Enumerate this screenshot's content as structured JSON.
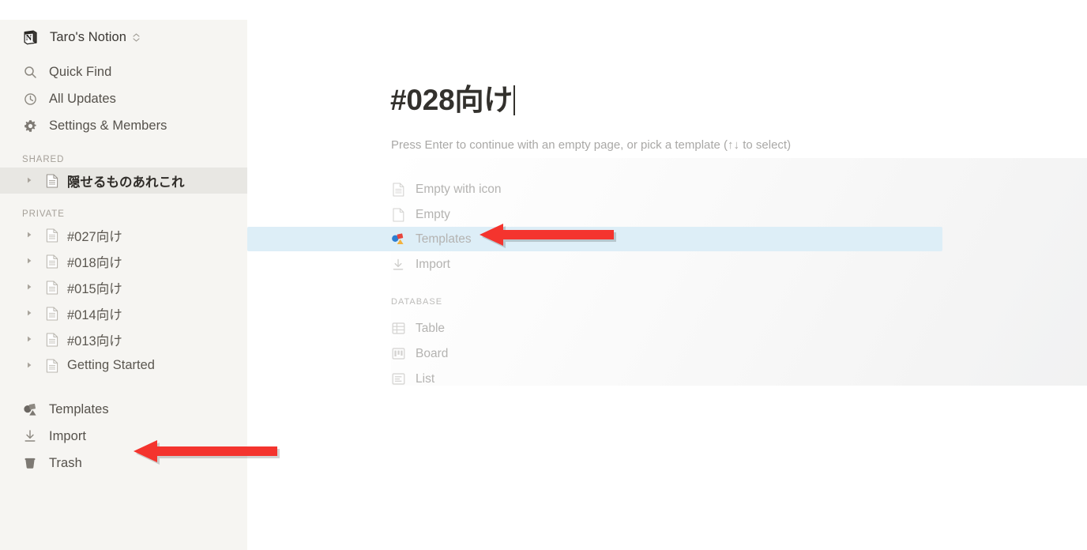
{
  "workspace": {
    "name": "Taro's Notion",
    "logo_icon": "notion-cube-icon",
    "switcher_icon": "chevron-updown-icon"
  },
  "sidebar": {
    "nav": [
      {
        "label": "Quick Find",
        "icon": "search-icon"
      },
      {
        "label": "All Updates",
        "icon": "clock-icon"
      },
      {
        "label": "Settings & Members",
        "icon": "gear-icon"
      }
    ],
    "shared": {
      "heading": "SHARED",
      "items": [
        {
          "label": "隠せるものあれこれ",
          "icon": "page-icon",
          "toggle": "chevron-right-icon",
          "selected": true
        }
      ]
    },
    "private": {
      "heading": "PRIVATE",
      "items": [
        {
          "label": "#027向け",
          "icon": "page-icon",
          "toggle": "chevron-right-icon",
          "selected": false
        },
        {
          "label": "#018向け",
          "icon": "page-icon",
          "toggle": "chevron-right-icon",
          "selected": false
        },
        {
          "label": "#015向け",
          "icon": "page-icon",
          "toggle": "chevron-right-icon",
          "selected": false
        },
        {
          "label": "#014向け",
          "icon": "page-icon",
          "toggle": "chevron-right-icon",
          "selected": false
        },
        {
          "label": "#013向け",
          "icon": "page-icon",
          "toggle": "chevron-right-icon",
          "selected": false
        },
        {
          "label": "Getting Started",
          "icon": "page-icon",
          "toggle": "chevron-right-icon",
          "selected": false
        }
      ]
    },
    "bottom": [
      {
        "label": "Templates",
        "icon": "templates-icon"
      },
      {
        "label": "Import",
        "icon": "import-icon"
      },
      {
        "label": "Trash",
        "icon": "trash-icon"
      }
    ]
  },
  "main": {
    "title": "#028向け",
    "hint": "Press Enter to continue with an empty page, or pick a template (↑↓ to select)",
    "options": [
      {
        "label": "Empty with icon",
        "icon": "page-lines-icon",
        "highlighted": false
      },
      {
        "label": "Empty",
        "icon": "page-blank-icon",
        "highlighted": false
      },
      {
        "label": "Templates",
        "icon": "templates-icon",
        "highlighted": true
      },
      {
        "label": "Import",
        "icon": "import-icon",
        "highlighted": false
      }
    ],
    "database_heading": "DATABASE",
    "database_options": [
      {
        "label": "Table",
        "icon": "table-icon"
      },
      {
        "label": "Board",
        "icon": "board-icon"
      },
      {
        "label": "List",
        "icon": "list-icon"
      }
    ]
  },
  "annotations": {
    "arrow_color": "#f4342e",
    "arrows": [
      {
        "name": "arrow-to-sidebar-templates",
        "target": "Templates"
      },
      {
        "name": "arrow-to-menu-templates",
        "target": "Templates"
      }
    ]
  },
  "colors": {
    "sidebar_bg": "#f6f5f2",
    "selected_row_bg": "#e8e7e3",
    "highlight_row_bg": "#ddeef7",
    "accent_red": "#f4342e"
  }
}
